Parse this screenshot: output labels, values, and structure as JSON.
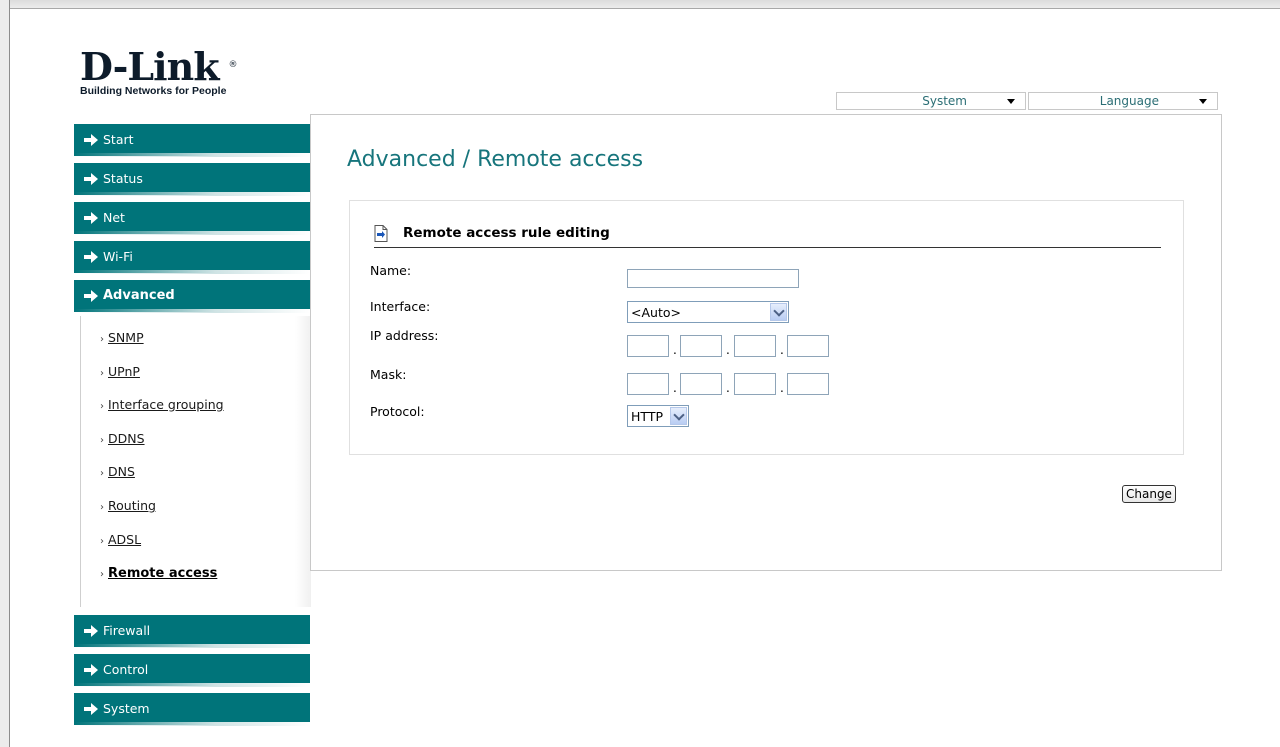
{
  "logo": {
    "name": "D-Link",
    "registered": "®",
    "tagline": "Building Networks for People"
  },
  "topbar": {
    "system_label": "System",
    "language_label": "Language"
  },
  "nav": {
    "items": [
      {
        "label": "Start"
      },
      {
        "label": "Status"
      },
      {
        "label": "Net"
      },
      {
        "label": "Wi-Fi"
      },
      {
        "label": "Advanced"
      },
      {
        "label": "Firewall"
      },
      {
        "label": "Control"
      },
      {
        "label": "System"
      }
    ],
    "advanced_sub": [
      {
        "label": "SNMP"
      },
      {
        "label": "UPnP"
      },
      {
        "label": "Interface grouping"
      },
      {
        "label": "DDNS"
      },
      {
        "label": "DNS"
      },
      {
        "label": "Routing"
      },
      {
        "label": "ADSL"
      },
      {
        "label": "Remote access"
      }
    ],
    "bullet": "›"
  },
  "main": {
    "title": "Advanced /  Remote access",
    "section_title": "Remote access rule editing",
    "name_label": "Name:",
    "name_value": "",
    "interface_label": "Interface:",
    "interface_value": "<Auto>",
    "ip_label": "IP address:",
    "mask_label": "Mask:",
    "protocol_label": "Protocol:",
    "protocol_value": "HTTP",
    "change_label": "Change"
  },
  "colors": {
    "accent": "#00747a",
    "title": "#17757c"
  }
}
